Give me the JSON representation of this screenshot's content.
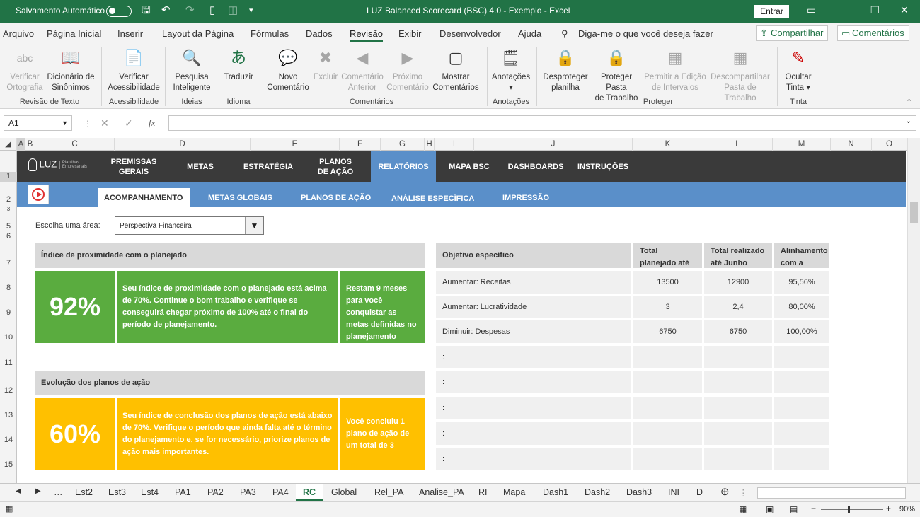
{
  "titlebar": {
    "autosave": "Salvamento Automático",
    "title": "LUZ Balanced Scorecard (BSC) 4.0 - Exemplo  -  Excel",
    "signin": "Entrar"
  },
  "menu": {
    "items": [
      "Arquivo",
      "Página Inicial",
      "Inserir",
      "Layout da Página",
      "Fórmulas",
      "Dados",
      "Revisão",
      "Exibir",
      "Desenvolvedor",
      "Ajuda"
    ],
    "tellme": "Diga-me o que você deseja fazer",
    "share": "Compartilhar",
    "comments": "Comentários"
  },
  "ribbon": {
    "buttons": [
      {
        "l1": "Verificar",
        "l2": "Ortografia",
        "icon": "abc"
      },
      {
        "l1": "Dicionário de",
        "l2": "Sinônimos",
        "icon": "📖"
      },
      {
        "l1": "Verificar",
        "l2": "Acessibilidade",
        "icon": "📄"
      },
      {
        "l1": "Pesquisa",
        "l2": "Inteligente",
        "icon": "🔍"
      },
      {
        "l1": "Traduzir",
        "l2": "",
        "icon": "あ"
      },
      {
        "l1": "Novo",
        "l2": "Comentário",
        "icon": "💬"
      },
      {
        "l1": "Excluir",
        "l2": "",
        "icon": "✖"
      },
      {
        "l1": "Comentário",
        "l2": "Anterior",
        "icon": "◀"
      },
      {
        "l1": "Próximo",
        "l2": "Comentário",
        "icon": "▶"
      },
      {
        "l1": "Mostrar",
        "l2": "Comentários",
        "icon": "▢"
      },
      {
        "l1": "Anotações",
        "l2": "▾",
        "icon": "🗒"
      },
      {
        "l1": "Desproteger",
        "l2": "planilha",
        "icon": "🔒"
      },
      {
        "l1": "Proteger Pasta",
        "l2": "de Trabalho",
        "icon": "🔒"
      },
      {
        "l1": "Permitir a Edição",
        "l2": "de Intervalos",
        "icon": "▦"
      },
      {
        "l1": "Descompartilhar",
        "l2": "Pasta de Trabalho",
        "icon": "▦"
      },
      {
        "l1": "Ocultar",
        "l2": "Tinta ▾",
        "icon": "✎"
      }
    ],
    "groups": [
      "Revisão de Texto",
      "Acessibilidade",
      "Ideias",
      "Idioma",
      "Comentários",
      "Anotações",
      "Proteger",
      "Tinta"
    ]
  },
  "formula": {
    "namebox": "A1",
    "fx": "fx"
  },
  "columns": [
    "A",
    "B",
    "C",
    "D",
    "E",
    "F",
    "G",
    "H",
    "I",
    "J",
    "K",
    "L",
    "M",
    "N",
    "O"
  ],
  "rows": [
    "1",
    "2",
    "3",
    "5",
    "6",
    "7",
    "8",
    "9",
    "10",
    "11",
    "12",
    "13",
    "14",
    "15"
  ],
  "dash": {
    "logo": "LUZ",
    "logo_sub": "Planilhas Empresariais",
    "nav": [
      "PREMISSAS GERAIS",
      "METAS",
      "ESTRATÉGIA",
      "PLANOS DE AÇÃO",
      "RELATÓRIOS",
      "MAPA BSC",
      "DASHBOARDS",
      "INSTRUÇÕES"
    ],
    "subnav": [
      "ACOMPANHAMENTO",
      "METAS GLOBAIS",
      "PLANOS DE AÇÃO",
      "ANÁLISE ESPECÍFICA",
      "IMPRESSÃO"
    ],
    "area_label": "Escolha uma área:",
    "area_value": "Perspectiva Financeira",
    "card1": {
      "title": "Índice de proximidade com o planejado",
      "value": "92%",
      "text": "Seu índice de proximidade com o planejado está acima de 70%. Continue o bom trabalho e verifique se conseguirá chegar próximo de 100% até o final do período de planejamento.",
      "side": "Restam 9 meses para você conquistar as metas definidas no planejamento"
    },
    "card2": {
      "title": "Evolução dos planos de ação",
      "value": "60%",
      "text": "Seu índice de conclusão dos planos de ação está abaixo de 70%. Verifique o período que ainda falta até o término do planejamento e, se for necessário, priorize planos de ação mais importantes.",
      "side": "Você concluiu 1 plano de ação de um total de 3"
    },
    "table": {
      "headers": [
        "Objetivo específico",
        "Total planejado até Junho",
        "Total realizado até Junho",
        "Alinhamento com a meta"
      ],
      "rows": [
        [
          "Aumentar: Receitas",
          "13500",
          "12900",
          "95,56%"
        ],
        [
          "Aumentar: Lucratividade",
          "3",
          "2,4",
          "80,00%"
        ],
        [
          "Diminuir: Despesas",
          "6750",
          "6750",
          "100,00%"
        ],
        [
          ":",
          "",
          "",
          ""
        ],
        [
          ":",
          "",
          "",
          ""
        ],
        [
          ":",
          "",
          "",
          ""
        ],
        [
          ":",
          "",
          "",
          ""
        ],
        [
          ":",
          "",
          "",
          ""
        ]
      ]
    }
  },
  "sheets": [
    "Est2",
    "Est3",
    "Est4",
    "PA1",
    "PA2",
    "PA3",
    "PA4",
    "RC",
    "Global",
    "Rel_PA",
    "Analise_PA",
    "RI",
    "Mapa",
    "Dash1",
    "Dash2",
    "Dash3",
    "INI",
    "D"
  ],
  "status": {
    "zoom": "90%"
  }
}
